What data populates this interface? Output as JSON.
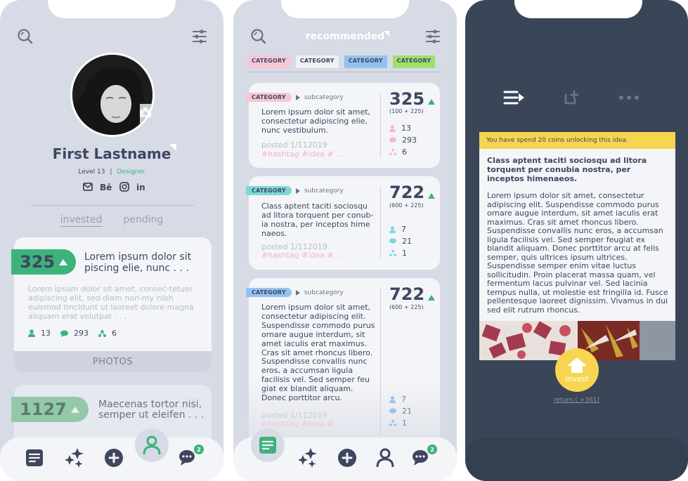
{
  "colors": {
    "accent_green": "#3db37c",
    "tag_pink": "#f7c7d5",
    "tag_teal": "#7fd7d8",
    "tag_blue": "#93c2ef",
    "tag_lime": "#9ee06b",
    "tag_gray": "#eef0f4",
    "banner_yellow": "#f7d550",
    "dark_bg": "#3a4558"
  },
  "profile": {
    "name": "First Lastname",
    "level": "Level 13",
    "separator": "|",
    "role": "Designer",
    "social_icons": [
      "mail-icon",
      "behance-icon",
      "instagram-icon",
      "linkedin-icon"
    ],
    "tabs": [
      {
        "label": "invested",
        "active": true
      },
      {
        "label": "pending",
        "active": false
      }
    ],
    "cards": [
      {
        "score": "325",
        "title": "Lorem ipsum dolor sit piscing elie, nunc . . .",
        "body": "Lorem ipsum dolor sit amet, consec-tetuer adipiscing elit, sed diam non-my nibh euismod tincidunt ut laoreet dolore magna aliquam erat volutpat . . .",
        "users": "13",
        "comments": "293",
        "shares": "6",
        "footer": "PHOTOS"
      },
      {
        "score": "1127",
        "title": "Maecenas tortor nisi, semper ut eleifen . . ."
      }
    ]
  },
  "feed": {
    "header": "recommended",
    "categories": [
      {
        "label": "CATEGORY",
        "color": "#f7c7d5"
      },
      {
        "label": "CATEGORY",
        "color": "#eef0f4"
      },
      {
        "label": "CATEGORY",
        "color": "#93c2ef"
      },
      {
        "label": "CATEGORY",
        "color": "#9ee06b"
      }
    ],
    "items": [
      {
        "category": "CATEGORY",
        "category_color": "#f7c7d5",
        "subcategory": "subcategory",
        "text": "Lorem ipsum dolor sit amet, consectetur adipiscing elie, nunc vestibulum.",
        "posted": "posted 1/112019",
        "tags": "#hashtag  #idea  # . . .",
        "score": "325",
        "delta": "(100 + 225)",
        "users": "13",
        "comments": "293",
        "shares": "6"
      },
      {
        "category": "CATEGORY",
        "category_color": "#7fd7d8",
        "subcategory": "subcategory",
        "text": "Class aptent taciti sociosqu ad litora torquent per conub-ia nostra, per inceptos hime naeos.",
        "posted": "posted 1/112019",
        "tags": "#hashtag  #idea  # . . .",
        "score": "722",
        "delta": "(600 + 225)",
        "users": "7",
        "comments": "21",
        "shares": "1"
      },
      {
        "category": "CATEGORY",
        "category_color": "#93c2ef",
        "subcategory": "subcategory",
        "text": "Lorem ipsum dolor sit amet, consectetur adipiscing elit. Suspendisse commodo purus ornare augue interdum, sit amet iaculis erat maximus. Cras sit amet rhoncus libero. Suspendisse convallis nunc eros, a accumsan ligula facilisis vel. Sed semper feu giat ex blandit aliquam. Donec porttitor arcu.",
        "posted": "posted 1/112019",
        "tags": "#hashtag  #idea  #",
        "score": "722",
        "delta": "(600 + 225)",
        "users": "7",
        "comments": "21",
        "shares": "1"
      }
    ]
  },
  "detail": {
    "banner": "You have spend 20 coins unlocking this idea.",
    "title": "Class aptent taciti sociosqu ad litora torquent per conubia nostra, per inceptos himenaeos.",
    "body": "Lorem ipsum dolor sit amet, consectetur adipiscing elit. Suspendisse commodo purus ornare augue interdum, sit amet iaculis erat maximus. Cras sit amet rhoncus libero. Suspendisse convallis nunc eros, a accumsan ligula facilisis vel. Sed semper feugiat ex blandit aliquam. Donec porttitor arcu at felis semper, quis ultrices ipsum ultrices. Suspendisse semper enim vitae luctus sollicitudin. Proin placerat massa quam, vel fermentum lacus pulvinar vel. Sed lacinia tempus nulla, ut molestie est fringilla id. Fusce pellentesque laoreet dignissim. Vivamus in dui sed elit rutrum rhoncus.",
    "invest_label": "Invest",
    "return_label": "return ( +361)"
  }
}
